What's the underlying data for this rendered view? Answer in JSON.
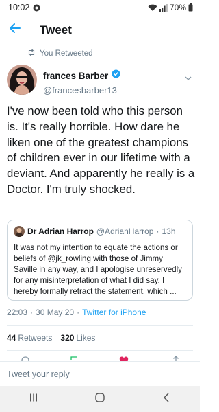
{
  "status_bar": {
    "time": "10:02",
    "battery": "70%",
    "icons": [
      "notification-icon",
      "wifi-icon",
      "signal-icon",
      "battery-icon"
    ]
  },
  "header": {
    "title": "Tweet",
    "back_icon": "back-arrow-icon"
  },
  "retweet_label": "You Retweeted",
  "tweet": {
    "author_name": "frances Barber",
    "author_handle": "@francesbarber13",
    "verified": true,
    "text": "I've now been told who this person is. It's really horrible. How dare he liken one of the greatest champions of children ever in our lifetime with a deviant. And apparently he really is a Doctor. I'm truly shocked.",
    "time": "22:03",
    "date": "30 May 20",
    "source": "Twitter for iPhone",
    "separator": "·"
  },
  "quoted_tweet": {
    "author_name": "Dr Adrian Harrop",
    "author_handle": "@AdrianHarrop",
    "age": "13h",
    "separator": "·",
    "text": "It was not my intention to equate the actions or beliefs of @jk_rowling with those of Jimmy Saville in any way, and I apologise unreservedly for any misinterpretation of what I did say. I hereby formally retract the statement, which ..."
  },
  "stats": {
    "retweets_count": "44",
    "retweets_label": "Retweets",
    "likes_count": "320",
    "likes_label": "Likes"
  },
  "reply": {
    "placeholder": "Tweet your reply"
  },
  "colors": {
    "accent": "#1da1f2",
    "secondary_text": "#657786",
    "like_red": "#e0245e",
    "retweet_green": "#17bf63"
  }
}
